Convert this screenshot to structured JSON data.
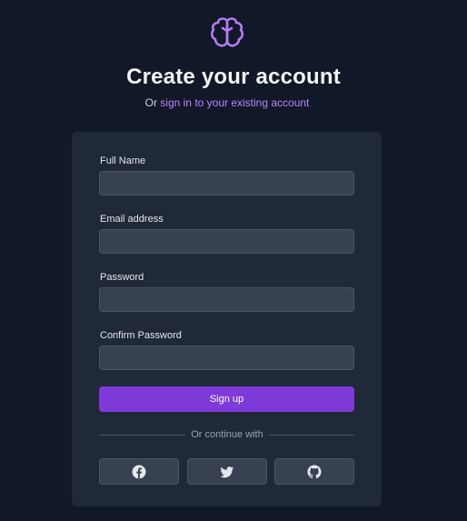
{
  "header": {
    "logo_icon": "brain-icon",
    "title": "Create your account",
    "subtitle_prefix": "Or",
    "subtitle_link": "sign in to your existing account"
  },
  "form": {
    "full_name_label": "Full Name",
    "email_label": "Email address",
    "password_label": "Password",
    "confirm_password_label": "Confirm Password",
    "submit_label": "Sign up",
    "divider_text": "Or continue with"
  },
  "social": [
    {
      "name": "facebook",
      "icon": "facebook-icon"
    },
    {
      "name": "twitter",
      "icon": "twitter-icon"
    },
    {
      "name": "github",
      "icon": "github-icon"
    }
  ],
  "colors": {
    "background": "#111827",
    "card": "#1f2937",
    "input": "#374151",
    "accent": "#7e3bd9",
    "link": "#c084fc"
  }
}
